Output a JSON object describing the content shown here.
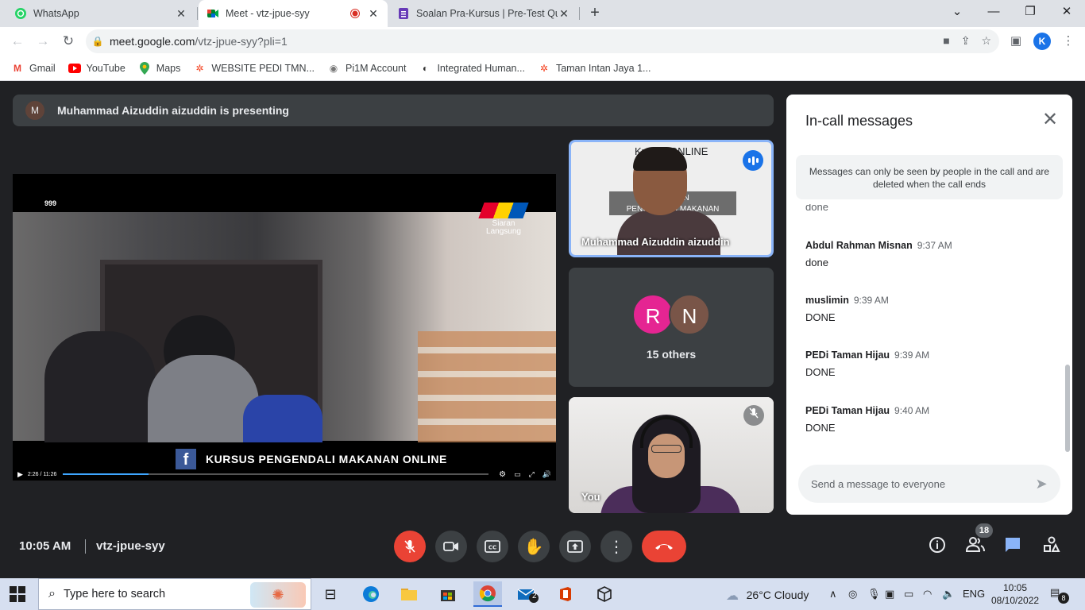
{
  "browser": {
    "tabs": [
      {
        "title": "WhatsApp",
        "icon": "whatsapp-icon",
        "close": "✕"
      },
      {
        "title": "Meet - vtz-jpue-syy",
        "icon": "meet-icon",
        "close": "✕",
        "recording_icon": "recording-icon"
      },
      {
        "title": "Soalan Pra-Kursus | Pre-Test Que",
        "icon": "forms-icon",
        "close": "✕"
      }
    ],
    "new_tab": "+",
    "window_controls": {
      "dropdown": "⌄",
      "minimize": "—",
      "restore": "❐",
      "close": "✕"
    },
    "url_domain": "meet.google.com",
    "url_path": "/vtz-jpue-syy?pli=1",
    "profile_initial": "K",
    "bookmarks": [
      "Gmail",
      "YouTube",
      "Maps",
      "WEBSITE PEDI TMN...",
      "Pi1M Account",
      "Integrated Human...",
      "Taman Intan Jaya 1..."
    ]
  },
  "meet": {
    "presenter_avatar": "M",
    "presenting_text": "Muhammad Aizuddin aizuddin is presenting",
    "stage": {
      "channel_number": "999",
      "broadcast_label": "Siaran Langsung",
      "fb_letter": "f",
      "caption": "KURSUS PENGENDALI MAKANAN ONLINE",
      "video_time": "2:26 / 11:26",
      "progress": 0.2
    },
    "tiles": {
      "presenter_slide_title": "Kursus ONLINE",
      "presenter_slide_box": "LATIHAN\nPENGENDALI MAKANAN",
      "presenter_name": "Muhammad Aizuddin aizuddin",
      "others_avatars": [
        {
          "letter": "R",
          "color": "#e52592"
        },
        {
          "letter": "N",
          "color": "#795548"
        }
      ],
      "others_label": "15 others",
      "self_name": "You"
    },
    "clock": "10:05 AM",
    "meeting_code": "vtz-jpue-syy",
    "people_count": "18"
  },
  "chat": {
    "title": "In-call messages",
    "notice": "Messages can only be seen by people in the call and are deleted when the call ends",
    "partial_text": "done",
    "messages": [
      {
        "sender": "Abdul Rahman Misnan",
        "time": "9:37 AM",
        "text": "done"
      },
      {
        "sender": "muslimin",
        "time": "9:39 AM",
        "text": "DONE"
      },
      {
        "sender": "PEDi Taman Hijau",
        "time": "9:39 AM",
        "text": "DONE"
      },
      {
        "sender": "PEDi Taman Hijau",
        "time": "9:40 AM",
        "text": "DONE"
      }
    ],
    "input_placeholder": "Send a message to everyone"
  },
  "taskbar": {
    "search_placeholder": "Type here to search",
    "weather": "26°C  Cloudy",
    "language": "ENG",
    "time": "10:05",
    "date": "08/10/2022",
    "mail_badge": "2",
    "notifications": "8"
  },
  "colors": {
    "meet_bg": "#202124",
    "accent_blue": "#1a73e8",
    "hangup_red": "#ea4335",
    "speaking_border": "#8ab4f8"
  }
}
